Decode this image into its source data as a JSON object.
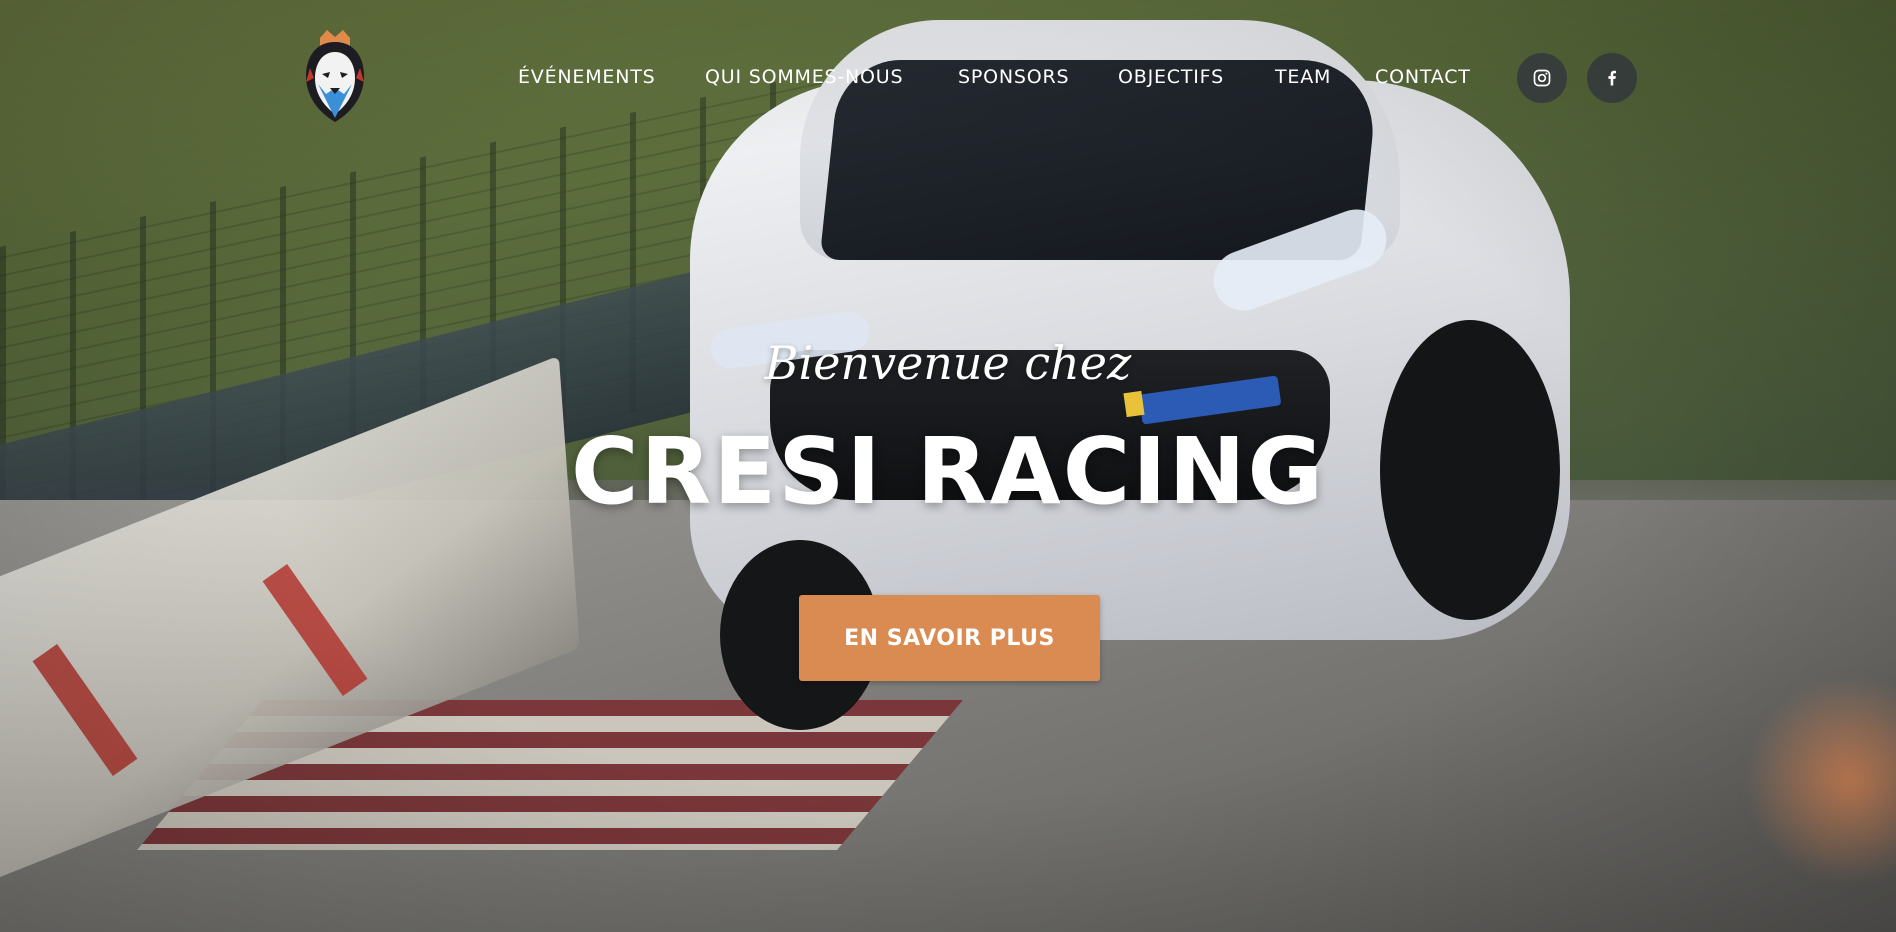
{
  "nav": {
    "logo_icon": "lion-head-logo-icon",
    "links": [
      {
        "label": "ÉVÉNEMENTS"
      },
      {
        "label": "QUI SOMMES-NOUS"
      },
      {
        "label": "SPONSORS"
      },
      {
        "label": "OBJECTIFS"
      },
      {
        "label": "TEAM"
      },
      {
        "label": "CONTACT"
      }
    ],
    "social": [
      {
        "icon": "instagram-icon"
      },
      {
        "icon": "facebook-icon"
      }
    ]
  },
  "hero": {
    "welcome": "Bienvenue chez",
    "title": "CRESI RACING",
    "cta_label": "EN SAVOIR PLUS",
    "background_image": "race-car-on-track-photo"
  },
  "colors": {
    "cta_background": "#d98b52",
    "text": "#ffffff",
    "social_background": "#32373c"
  }
}
